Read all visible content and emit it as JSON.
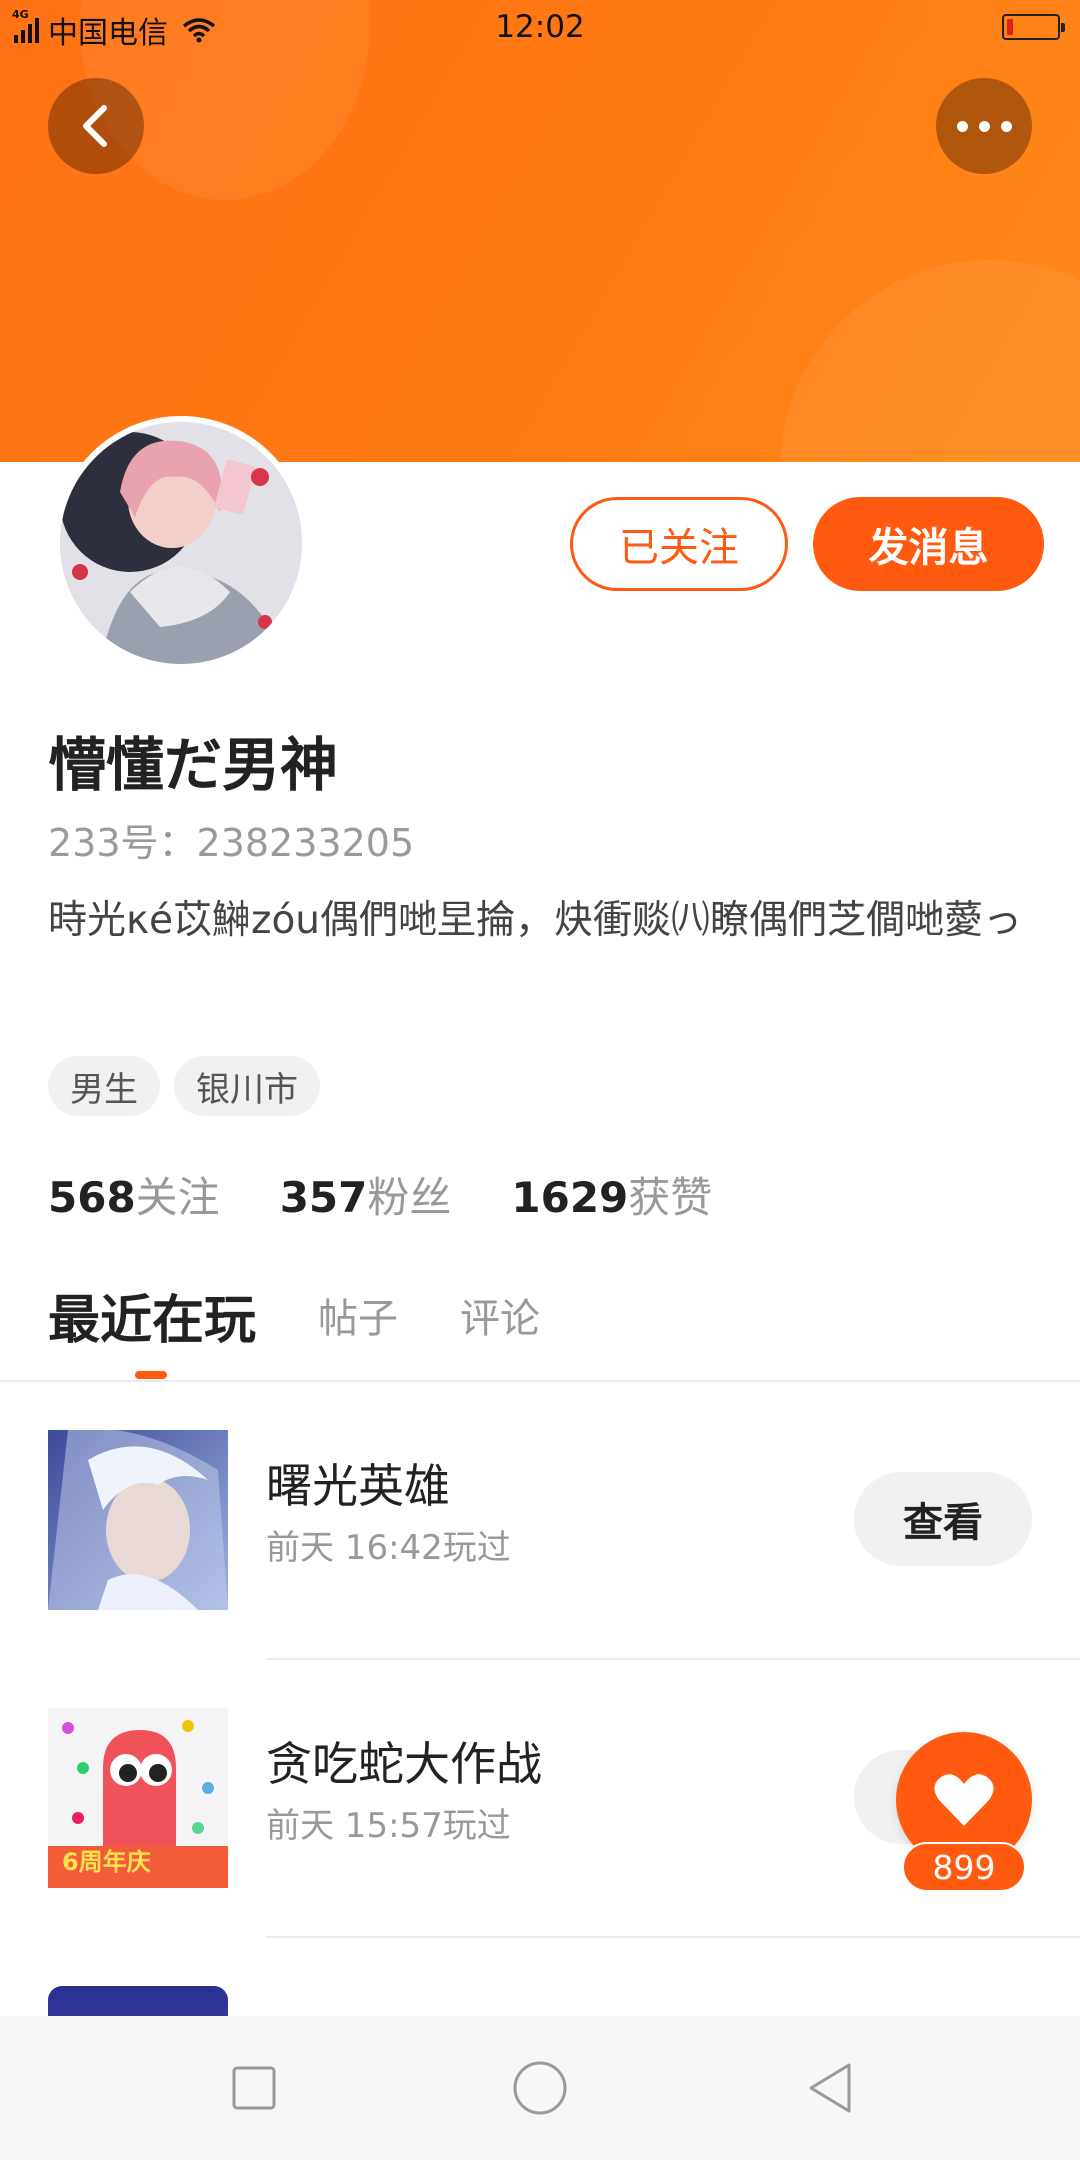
{
  "status_bar": {
    "network": "4G",
    "carrier": "中国电信",
    "time": "12:02",
    "battery_level": 0.12,
    "battery_color": "#e02020"
  },
  "theme": {
    "accent": "#ff5a0f",
    "header_gradient": [
      "#ff7215",
      "#ff8a1c"
    ]
  },
  "header": {
    "back_icon": "chevron-left-icon",
    "more_icon": "more-dots-icon"
  },
  "profile": {
    "name": "懵懂だ男神",
    "id_text": "233号：238233205",
    "bio": "時光κé苡鰰zóu偶們哋圼掄，炔衝赕㈧瞭偶們芝僴哋薆っ",
    "tags": [
      "男生",
      "银川市"
    ],
    "followed_label": "已关注",
    "message_label": "发消息",
    "stats": [
      {
        "value": "568",
        "label": "关注"
      },
      {
        "value": "357",
        "label": "粉丝"
      },
      {
        "value": "1629",
        "label": "获赞"
      }
    ]
  },
  "tabs": [
    {
      "label": "最近在玩",
      "active": true
    },
    {
      "label": "帖子",
      "active": false
    },
    {
      "label": "评论",
      "active": false
    }
  ],
  "games": [
    {
      "name": "曙光英雄",
      "time": "前天 16:42玩过",
      "button": "查看"
    },
    {
      "name": "贪吃蛇大作战",
      "time": "前天 15:57玩过",
      "button": ""
    }
  ],
  "thumbnail_text": {
    "snake_badge": "6周年庆"
  },
  "like_fab": {
    "icon": "heart-icon",
    "count": "899"
  },
  "nav_bar": {
    "icons": [
      "recents-square-icon",
      "home-circle-icon",
      "back-triangle-icon"
    ]
  }
}
